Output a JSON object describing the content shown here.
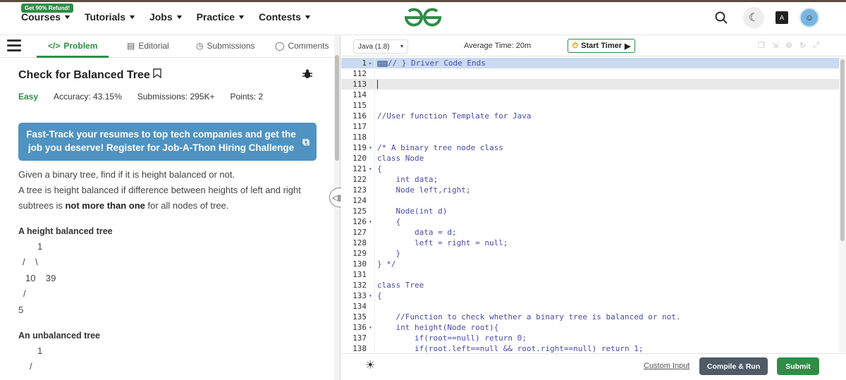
{
  "topbar": {
    "promo": "Get 90% Refund!",
    "nav": [
      "Courses",
      "Tutorials",
      "Jobs",
      "Practice",
      "Contests"
    ],
    "brand_color": "#2f8d46"
  },
  "tabs": {
    "problem": "Problem",
    "editorial": "Editorial",
    "submissions": "Submissions",
    "comments": "Comments"
  },
  "problem": {
    "title": "Check for Balanced Tree",
    "difficulty": "Easy",
    "accuracy": "Accuracy: 43.15%",
    "submissions": "Submissions: 295K+",
    "points": "Points: 2",
    "banner": "Fast-Track your resumes to top tech companies and get the job you deserve! Register for Job-A-Thon Hiring Challenge",
    "desc1": "Given a binary tree, find if it is height balanced or not.",
    "desc2_a": "A tree is height balanced if difference between heights of left and right subtrees is ",
    "desc2_b": "not more than one",
    "desc2_c": " for all nodes of tree.",
    "balanced_heading": "A height balanced tree",
    "tree1": [
      "1",
      "/    \\",
      "10    39",
      "/",
      "5"
    ],
    "unbalanced_heading": "An unbalanced tree",
    "tree2": [
      "1",
      "/"
    ]
  },
  "editor": {
    "language": "Java (1.8)",
    "avg_time": "Average Time: 20m",
    "start_timer": "Start Timer",
    "custom_input": "Custom Input",
    "compile_run": "Compile & Run",
    "submit": "Submit",
    "lines": [
      {
        "n": "1",
        "fold": "▸",
        "tag": "···",
        "text": "// } Driver Code Ends"
      },
      {
        "n": "112",
        "fold": "",
        "text": ""
      },
      {
        "n": "113",
        "fold": "",
        "text": ""
      },
      {
        "n": "114",
        "fold": "",
        "text": ""
      },
      {
        "n": "115",
        "fold": "",
        "text": ""
      },
      {
        "n": "116",
        "fold": "",
        "text": "//User function Template for Java"
      },
      {
        "n": "117",
        "fold": "",
        "text": ""
      },
      {
        "n": "118",
        "fold": "",
        "text": ""
      },
      {
        "n": "119",
        "fold": "▾",
        "text": "/* A binary tree node class"
      },
      {
        "n": "120",
        "fold": "",
        "text": "class Node"
      },
      {
        "n": "121",
        "fold": "▾",
        "text": "{"
      },
      {
        "n": "122",
        "fold": "",
        "text": "    int data;"
      },
      {
        "n": "123",
        "fold": "",
        "text": "    Node left,right;"
      },
      {
        "n": "124",
        "fold": "",
        "text": ""
      },
      {
        "n": "125",
        "fold": "",
        "text": "    Node(int d)"
      },
      {
        "n": "126",
        "fold": "▾",
        "text": "    {"
      },
      {
        "n": "127",
        "fold": "",
        "text": "        data = d;"
      },
      {
        "n": "128",
        "fold": "",
        "text": "        left = right = null;"
      },
      {
        "n": "129",
        "fold": "",
        "text": "    }"
      },
      {
        "n": "130",
        "fold": "",
        "text": "} */"
      },
      {
        "n": "131",
        "fold": "",
        "text": ""
      },
      {
        "n": "132",
        "fold": "",
        "text": "class Tree"
      },
      {
        "n": "133",
        "fold": "▾",
        "text": "{"
      },
      {
        "n": "134",
        "fold": "",
        "text": ""
      },
      {
        "n": "135",
        "fold": "",
        "text": "    //Function to check whether a binary tree is balanced or not."
      },
      {
        "n": "136",
        "fold": "▾",
        "text": "    int height(Node root){"
      },
      {
        "n": "137",
        "fold": "",
        "text": "        if(root==null) return 0;"
      },
      {
        "n": "138",
        "fold": "",
        "text": "        if(root.left==null && root.right==null) return 1;"
      }
    ]
  }
}
